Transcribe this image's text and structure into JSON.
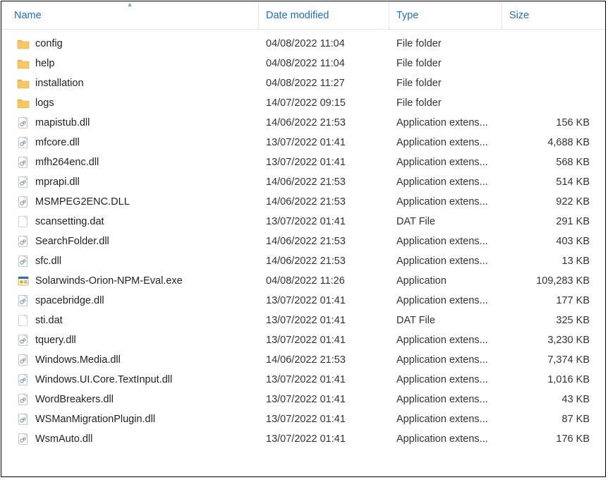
{
  "columns": {
    "name": "Name",
    "date": "Date modified",
    "type": "Type",
    "size": "Size"
  },
  "sort": {
    "column": "name",
    "direction": "asc"
  },
  "rows": [
    {
      "icon": "folder",
      "name": "config",
      "date": "04/08/2022 11:04",
      "type": "File folder",
      "size": ""
    },
    {
      "icon": "folder",
      "name": "help",
      "date": "04/08/2022 11:04",
      "type": "File folder",
      "size": ""
    },
    {
      "icon": "folder",
      "name": "installation",
      "date": "04/08/2022 11:27",
      "type": "File folder",
      "size": ""
    },
    {
      "icon": "folder",
      "name": "logs",
      "date": "14/07/2022 09:15",
      "type": "File folder",
      "size": ""
    },
    {
      "icon": "dll",
      "name": "mapistub.dll",
      "date": "14/06/2022 21:53",
      "type": "Application extens...",
      "size": "156 KB"
    },
    {
      "icon": "dll",
      "name": "mfcore.dll",
      "date": "13/07/2022 01:41",
      "type": "Application extens...",
      "size": "4,688 KB"
    },
    {
      "icon": "dll",
      "name": "mfh264enc.dll",
      "date": "13/07/2022 01:41",
      "type": "Application extens...",
      "size": "568 KB"
    },
    {
      "icon": "dll",
      "name": "mprapi.dll",
      "date": "14/06/2022 21:53",
      "type": "Application extens...",
      "size": "514 KB"
    },
    {
      "icon": "dll",
      "name": "MSMPEG2ENC.DLL",
      "date": "14/06/2022 21:53",
      "type": "Application extens...",
      "size": "922 KB"
    },
    {
      "icon": "dat",
      "name": "scansetting.dat",
      "date": "13/07/2022 01:41",
      "type": "DAT File",
      "size": "291 KB"
    },
    {
      "icon": "dll",
      "name": "SearchFolder.dll",
      "date": "14/06/2022 21:53",
      "type": "Application extens...",
      "size": "403 KB"
    },
    {
      "icon": "dll",
      "name": "sfc.dll",
      "date": "14/06/2022 21:53",
      "type": "Application extens...",
      "size": "13 KB"
    },
    {
      "icon": "exe",
      "name": "Solarwinds-Orion-NPM-Eval.exe",
      "date": "04/08/2022 11:26",
      "type": "Application",
      "size": "109,283 KB"
    },
    {
      "icon": "dll",
      "name": "spacebridge.dll",
      "date": "13/07/2022 01:41",
      "type": "Application extens...",
      "size": "177 KB"
    },
    {
      "icon": "dat",
      "name": "sti.dat",
      "date": "13/07/2022 01:41",
      "type": "DAT File",
      "size": "325 KB"
    },
    {
      "icon": "dll",
      "name": "tquery.dll",
      "date": "13/07/2022 01:41",
      "type": "Application extens...",
      "size": "3,230 KB"
    },
    {
      "icon": "dll",
      "name": "Windows.Media.dll",
      "date": "14/06/2022 21:53",
      "type": "Application extens...",
      "size": "7,374 KB"
    },
    {
      "icon": "dll",
      "name": "Windows.UI.Core.TextInput.dll",
      "date": "13/07/2022 01:41",
      "type": "Application extens...",
      "size": "1,016 KB"
    },
    {
      "icon": "dll",
      "name": "WordBreakers.dll",
      "date": "13/07/2022 01:41",
      "type": "Application extens...",
      "size": "43 KB"
    },
    {
      "icon": "dll",
      "name": "WSManMigrationPlugin.dll",
      "date": "13/07/2022 01:41",
      "type": "Application extens...",
      "size": "87 KB"
    },
    {
      "icon": "dll",
      "name": "WsmAuto.dll",
      "date": "13/07/2022 01:41",
      "type": "Application extens...",
      "size": "176 KB"
    }
  ]
}
